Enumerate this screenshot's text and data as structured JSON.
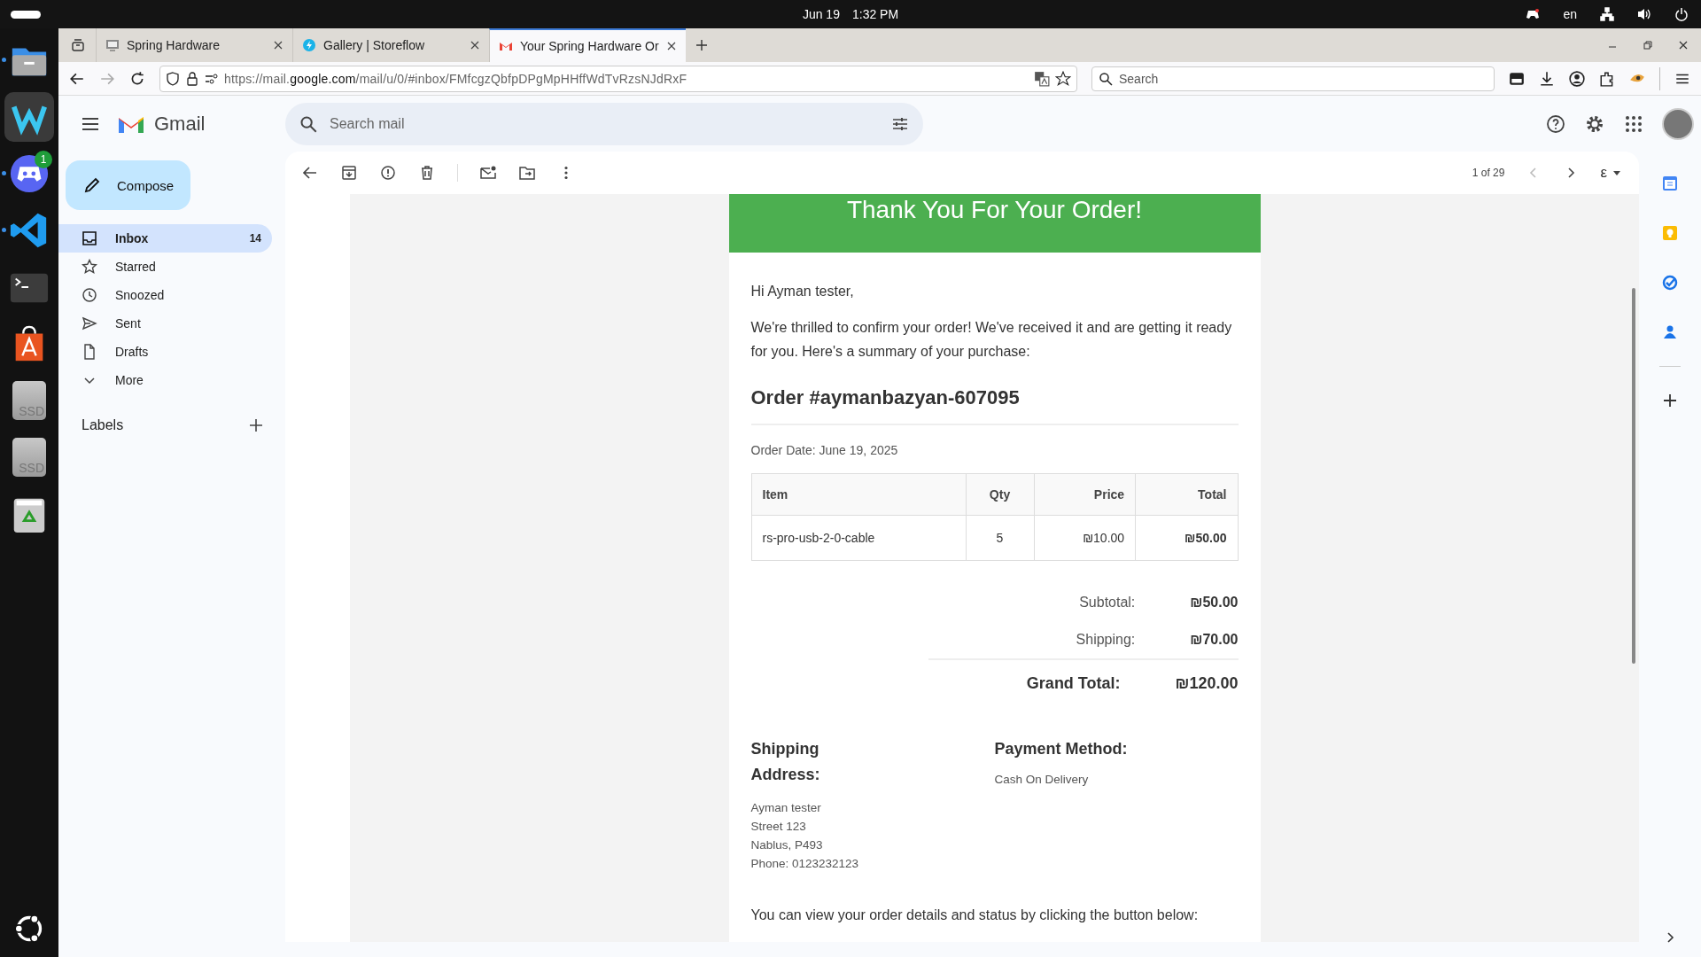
{
  "top_bar": {
    "date": "Jun 19",
    "time": "1:32 PM",
    "language": "en"
  },
  "dock": [
    {
      "kind": "files",
      "running": true,
      "focused": false
    },
    {
      "kind": "wave",
      "running": false,
      "focused": true
    },
    {
      "kind": "chat",
      "running": true,
      "focused": false,
      "badge": "1"
    },
    {
      "kind": "code",
      "running": true,
      "focused": false
    },
    {
      "kind": "terminal",
      "running": false,
      "focused": false
    },
    {
      "kind": "store",
      "running": false,
      "focused": false
    },
    {
      "kind": "drive",
      "running": false,
      "focused": false,
      "label": "SSD"
    },
    {
      "kind": "drive",
      "running": false,
      "focused": false,
      "label": "SSD"
    },
    {
      "kind": "trash",
      "running": false,
      "focused": false
    }
  ],
  "browser": {
    "tabs": [
      {
        "title": "Spring Hardware",
        "kind": "page",
        "selected": false
      },
      {
        "title": "Gallery | Storeflow",
        "kind": "bolt",
        "selected": false
      },
      {
        "title": "Your Spring Hardware Or",
        "kind": "mail",
        "selected": true
      }
    ],
    "url": {
      "prefix": "https://mail.",
      "domain": "google.com",
      "path": "/mail/u/0/#inbox/FMfcgzQbfpDPgMpHHffWdTvRzsNJdRxF"
    },
    "search": {
      "placeholder": "Search"
    }
  },
  "gmail": {
    "brand": "Gmail",
    "search": {
      "placeholder": "Search mail"
    },
    "compose": "Compose",
    "nav": [
      {
        "label": "Inbox",
        "kind": "inbox",
        "count": "14",
        "selected": true
      },
      {
        "label": "Starred",
        "kind": "star",
        "selected": false
      },
      {
        "label": "Snoozed",
        "kind": "clock",
        "selected": false
      },
      {
        "label": "Sent",
        "kind": "send",
        "selected": false
      },
      {
        "label": "Drafts",
        "kind": "file",
        "selected": false
      },
      {
        "label": "More",
        "kind": "chevron",
        "selected": false
      }
    ],
    "labels_heading": "Labels",
    "toolbar": {
      "pager": "1 of 29",
      "input_tool": "ε"
    }
  },
  "email": {
    "header": "Thank You For Your Order!",
    "greeting": "Hi Ayman tester,",
    "intro": "We're thrilled to confirm your order! We've received it and are getting it ready for you. Here's a summary of your purchase:",
    "order_title": "Order #aymanbazyan-607095",
    "order_date": "Order Date: June 19, 2025",
    "table": {
      "columns": [
        "Item",
        "Qty",
        "Price",
        "Total"
      ],
      "rows": [
        [
          "rs-pro-usb-2-0-cable",
          "5",
          "₪10.00",
          "₪50.00"
        ]
      ]
    },
    "totals": [
      {
        "label": "Subtotal:",
        "value": "₪50.00",
        "kind": "line"
      },
      {
        "label": "Shipping:",
        "value": "₪70.00",
        "kind": "line"
      },
      {
        "label": "Grand Total:",
        "value": "₪120.00",
        "kind": "grand"
      }
    ],
    "shipping": {
      "heading": "Shipping Address:",
      "lines": [
        "Ayman tester",
        "Street 123",
        "Nablus, P493",
        "Phone: 0123232123"
      ]
    },
    "payment": {
      "heading": "Payment Method:",
      "value": "Cash On Delivery"
    },
    "footer": "You can view your order details and status by clicking the button below:"
  }
}
